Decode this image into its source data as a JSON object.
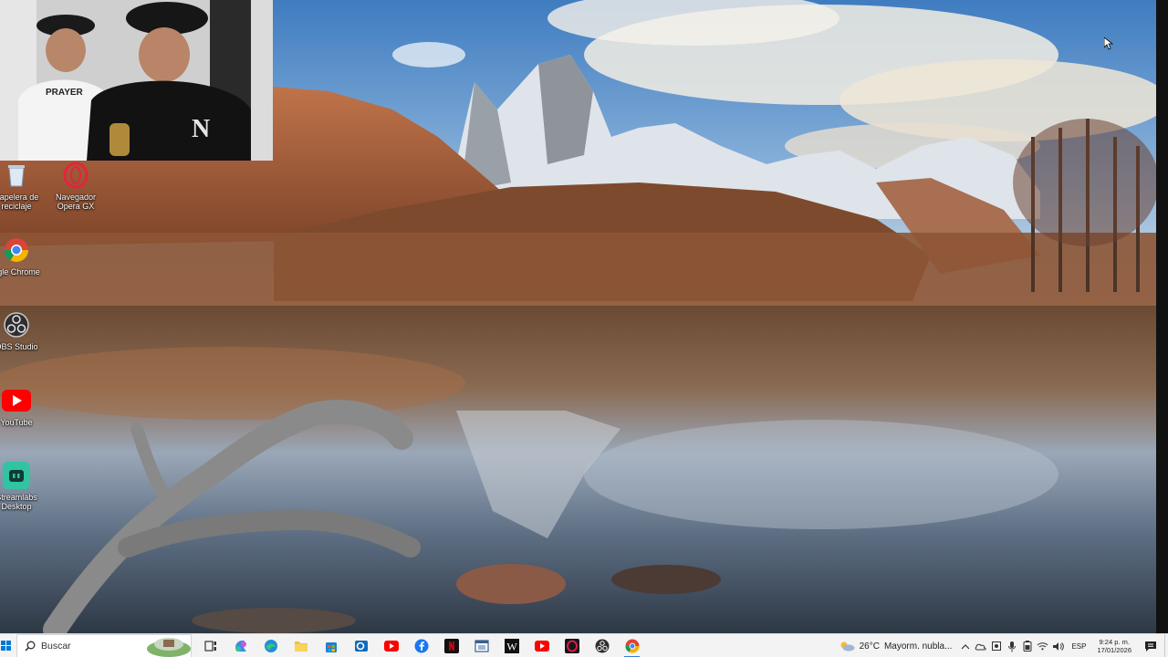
{
  "webcam": {
    "shirt_text": "PRAYER"
  },
  "desktop_icons": [
    {
      "label": "Papelera de\nreciclaje",
      "icon": "recycle-bin-icon"
    },
    {
      "label": "Navegador\nOpera GX",
      "icon": "opera-gx-icon"
    },
    {
      "label": "ogle Chrome",
      "icon": "chrome-icon"
    },
    {
      "label": "OBS Studio",
      "icon": "obs-icon"
    },
    {
      "label": "YouTube",
      "icon": "youtube-icon"
    },
    {
      "label": "Streamlabs\nDesktop",
      "icon": "streamlabs-icon"
    }
  ],
  "taskbar": {
    "search_placeholder": "Buscar",
    "pinned": [
      {
        "name": "task-view",
        "icon": "task-view-icon"
      },
      {
        "name": "copilot",
        "icon": "copilot-icon"
      },
      {
        "name": "edge",
        "icon": "edge-icon"
      },
      {
        "name": "file-explorer",
        "icon": "folder-icon"
      },
      {
        "name": "store",
        "icon": "store-icon"
      },
      {
        "name": "outlook",
        "icon": "outlook-icon"
      },
      {
        "name": "youtube",
        "icon": "youtube-icon"
      },
      {
        "name": "facebook",
        "icon": "facebook-icon"
      },
      {
        "name": "netflix",
        "icon": "netflix-icon"
      },
      {
        "name": "app-window",
        "icon": "window-app-icon"
      },
      {
        "name": "wikipedia",
        "icon": "wikipedia-icon"
      },
      {
        "name": "youtube-2",
        "icon": "youtube-icon"
      },
      {
        "name": "opera-gx",
        "icon": "opera-gx-icon"
      },
      {
        "name": "obs",
        "icon": "obs-icon"
      },
      {
        "name": "chrome",
        "icon": "chrome-icon"
      }
    ],
    "active_app": "chrome"
  },
  "tray": {
    "weather_temp": "26°C",
    "weather_desc": "Mayorm. nubla...",
    "language": "ESP",
    "time": "9:24 p. m.",
    "date": "17/01/2026"
  },
  "colors": {
    "taskbar_bg": "#f3f3f3",
    "accent": "#3b7fd4",
    "youtube_red": "#ff0000",
    "chrome_blue": "#4285f4",
    "streamlabs_green": "#31c3a2"
  }
}
